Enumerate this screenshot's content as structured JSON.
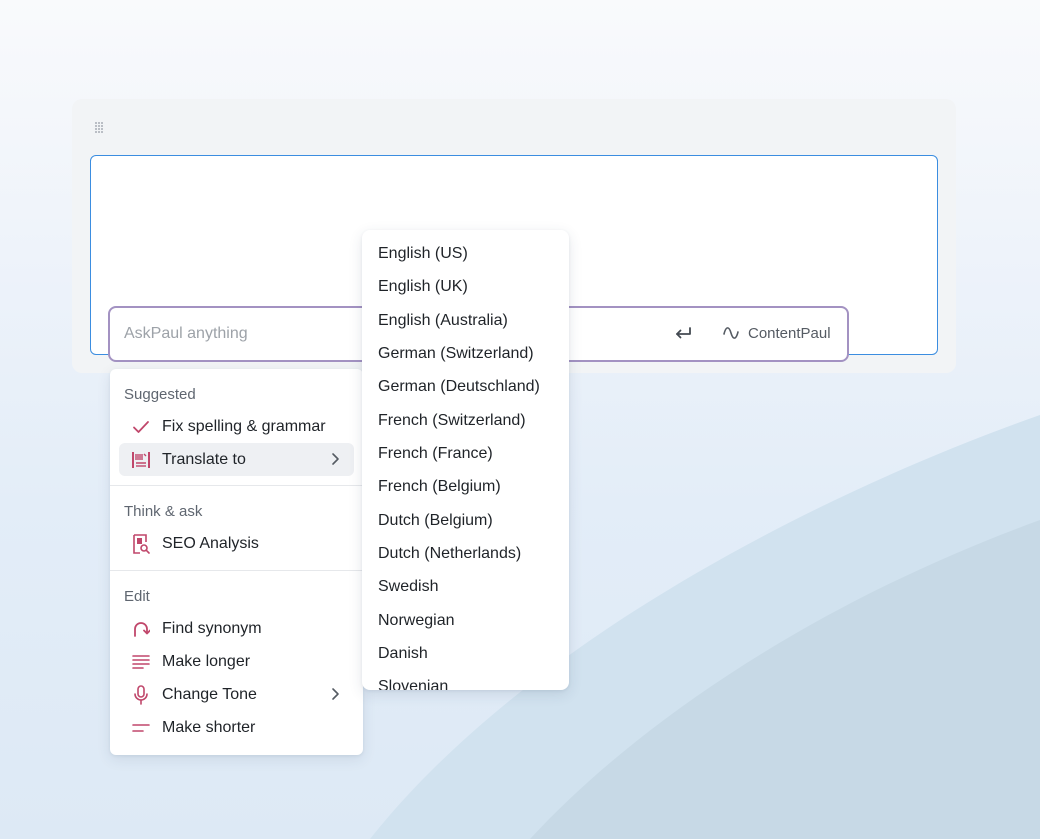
{
  "ask_bar": {
    "placeholder": "AskPaul anything",
    "brand_label": "ContentPaul"
  },
  "menu": {
    "sections": [
      {
        "label": "Suggested",
        "items": [
          {
            "label": "Fix spelling & grammar",
            "icon": "check-icon",
            "has_submenu": false
          },
          {
            "label": "Translate to",
            "icon": "translate-icon",
            "has_submenu": true,
            "active": true
          }
        ]
      },
      {
        "label": "Think & ask",
        "items": [
          {
            "label": "SEO Analysis",
            "icon": "seo-analysis-icon",
            "has_submenu": false
          }
        ]
      },
      {
        "label": "Edit",
        "items": [
          {
            "label": "Find synonym",
            "icon": "redo-arrow-icon",
            "has_submenu": false
          },
          {
            "label": "Make longer",
            "icon": "text-lines-icon",
            "has_submenu": false
          },
          {
            "label": "Change Tone",
            "icon": "microphone-icon",
            "has_submenu": true
          },
          {
            "label": "Make shorter",
            "icon": "short-lines-icon",
            "has_submenu": false
          }
        ]
      }
    ]
  },
  "translate_submenu": {
    "languages": [
      "English (US)",
      "English (UK)",
      "English (Australia)",
      "German (Switzerland)",
      "German (Deutschland)",
      "French (Switzerland)",
      "French (France)",
      "French (Belgium)",
      "Dutch (Belgium)",
      "Dutch (Netherlands)",
      "Swedish",
      "Norwegian",
      "Danish",
      "Slovenian"
    ]
  },
  "colors": {
    "accent_pink": "#c0476b",
    "focus_blue": "#3b8de0",
    "ask_border_purple": "#a392c2"
  }
}
